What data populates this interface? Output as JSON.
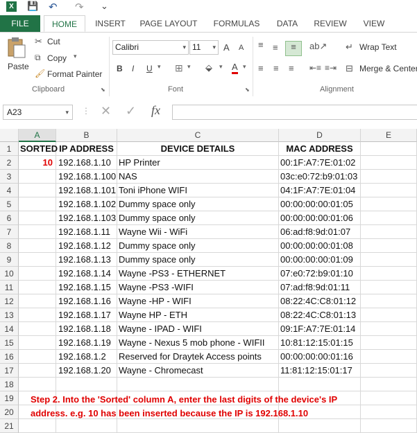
{
  "quick_access": {
    "logo": "X",
    "save": "💾",
    "undo": "↶",
    "redo": "↷",
    "customize": "⌄"
  },
  "tabs": [
    "FILE",
    "HOME",
    "INSERT",
    "PAGE LAYOUT",
    "FORMULAS",
    "DATA",
    "REVIEW",
    "VIEW"
  ],
  "ribbon": {
    "paste_label": "Paste",
    "cut_label": "Cut",
    "copy_label": "Copy",
    "format_painter_label": "Format Painter",
    "clipboard_group": "Clipboard",
    "font_name": "Calibri",
    "font_size": "11",
    "grow_font": "A",
    "shrink_font": "A",
    "bold": "B",
    "italic": "I",
    "underline": "U",
    "font_color": "A",
    "font_group": "Font",
    "wrap_text_label": "Wrap Text",
    "merge_center_label": "Merge & Center",
    "alignment_group": "Alignment"
  },
  "formula_bar": {
    "name_box": "A23",
    "cancel": "✕",
    "enter": "✓",
    "fx": "fx",
    "value": ""
  },
  "columns": [
    "A",
    "B",
    "C",
    "D",
    "E"
  ],
  "rows": [
    {
      "num": "1",
      "a": "SORTED",
      "b": "IP ADDRESS",
      "c": "DEVICE DETAILS",
      "d": "MAC ADDRESS"
    },
    {
      "num": "2",
      "a": "10",
      "b": "192.168.1.10",
      "c": "HP  Printer",
      "d": "00:1F:A7:7E:01:02"
    },
    {
      "num": "3",
      "a": "",
      "b": "192.168.1.100",
      "c": "NAS",
      "d": "03c:e0:72:b9:01:03"
    },
    {
      "num": "4",
      "a": "",
      "b": "192.168.1.101",
      "c": "Toni iPhone WIFI",
      "d": "04:1F:A7:7E:01:04"
    },
    {
      "num": "5",
      "a": "",
      "b": "192.168.1.102",
      "c": "Dummy space only",
      "d": "00:00:00:00:01:05"
    },
    {
      "num": "6",
      "a": "",
      "b": "192.168.1.103",
      "c": "Dummy space only",
      "d": "00:00:00:00:01:06"
    },
    {
      "num": "7",
      "a": "",
      "b": "192.168.1.11",
      "c": "Wayne Wii - WiFi",
      "d": "06:ad:f8:9d:01:07"
    },
    {
      "num": "8",
      "a": "",
      "b": "192.168.1.12",
      "c": "Dummy space only",
      "d": "00:00:00:00:01:08"
    },
    {
      "num": "9",
      "a": "",
      "b": "192.168.1.13",
      "c": "Dummy space only",
      "d": "00:00:00:00:01:09"
    },
    {
      "num": "10",
      "a": "",
      "b": "192.168.1.14",
      "c": "Wayne -PS3 - ETHERNET",
      "d": "07:e0:72:b9:01:10"
    },
    {
      "num": "11",
      "a": "",
      "b": "192.168.1.15",
      "c": "Wayne -PS3 -WIFI",
      "d": "07:ad:f8:9d:01:11"
    },
    {
      "num": "12",
      "a": "",
      "b": "192.168.1.16",
      "c": "Wayne -HP - WIFI",
      "d": "08:22:4C:C8:01:12"
    },
    {
      "num": "13",
      "a": "",
      "b": "192.168.1.17",
      "c": "Wayne  HP - ETH",
      "d": "08:22:4C:C8:01:13"
    },
    {
      "num": "14",
      "a": "",
      "b": "192.168.1.18",
      "c": "Wayne - IPAD - WIFI",
      "d": "09:1F:A7:7E:01:14"
    },
    {
      "num": "15",
      "a": "",
      "b": "192.168.1.19",
      "c": "Wayne - Nexus 5 mob phone - WIFII",
      "d": "10:81:12:15:01:15"
    },
    {
      "num": "16",
      "a": "",
      "b": "192.168.1.2",
      "c": "Reserved for Draytek Access points",
      "d": "00:00:00:00:01:16"
    },
    {
      "num": "17",
      "a": "",
      "b": "192.168.1.20",
      "c": "Wayne - Chromecast",
      "d": "11:81:12:15:01:17"
    },
    {
      "num": "18",
      "a": "",
      "b": "",
      "c": "",
      "d": ""
    },
    {
      "num": "19",
      "a": "",
      "b": "",
      "c": "",
      "d": ""
    },
    {
      "num": "20",
      "a": "",
      "b": "",
      "c": "",
      "d": ""
    },
    {
      "num": "21",
      "a": "",
      "b": "",
      "c": "",
      "d": ""
    }
  ],
  "notes": {
    "line1": "Step 2.  Into the 'Sorted' column A, enter the last digits of the device's IP",
    "line2": "address.   e.g.  10 has been inserted because the IP is 192.168.1.10"
  },
  "colors": {
    "excel_green": "#217346",
    "note_red": "#e00000"
  }
}
